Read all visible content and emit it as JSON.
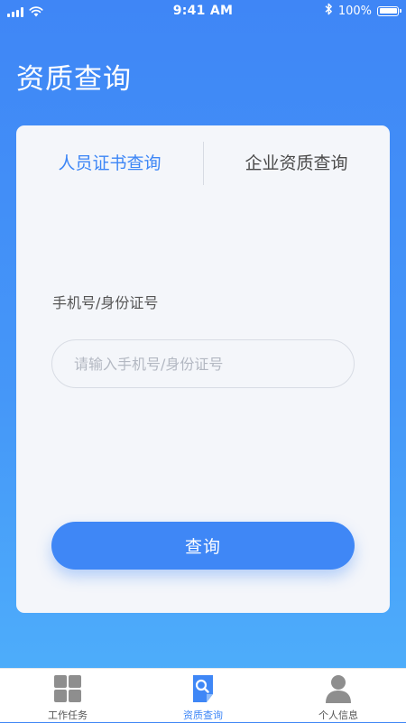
{
  "status_bar": {
    "time": "9:41 AM",
    "battery": "100%",
    "battery_level": 1.0
  },
  "header": {
    "title": "资质查询"
  },
  "tabs": [
    {
      "label": "人员证书查询",
      "active": true
    },
    {
      "label": "企业资质查询",
      "active": false
    }
  ],
  "form": {
    "field_label": "手机号/身份证号",
    "input_value": "",
    "input_placeholder": "请输入手机号/身份证号",
    "submit_label": "查询"
  },
  "bottom_nav": {
    "items": [
      {
        "label": "工作任务",
        "icon": "grid-icon",
        "active": false
      },
      {
        "label": "资质查询",
        "icon": "document-search-icon",
        "active": true
      },
      {
        "label": "个人信息",
        "icon": "person-icon",
        "active": false
      }
    ]
  },
  "colors": {
    "accent": "#3f87f6",
    "inactive_text": "#555555"
  }
}
